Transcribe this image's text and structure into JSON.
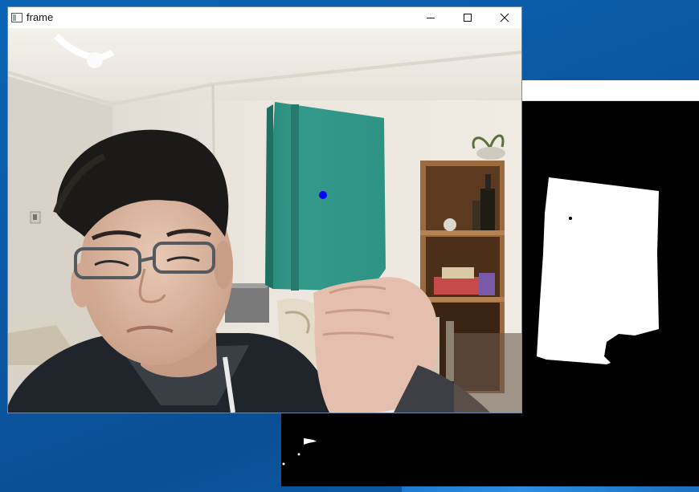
{
  "main_window": {
    "title": "frame",
    "controls": {
      "minimize": "minimize-icon",
      "maximize": "maximize-icon",
      "close": "close-icon"
    }
  },
  "colors": {
    "tracked_point": "#0000ff",
    "book": "#2e9384",
    "wall": "#e9e3d9",
    "mask_foreground": "#ffffff",
    "mask_background": "#000000"
  }
}
